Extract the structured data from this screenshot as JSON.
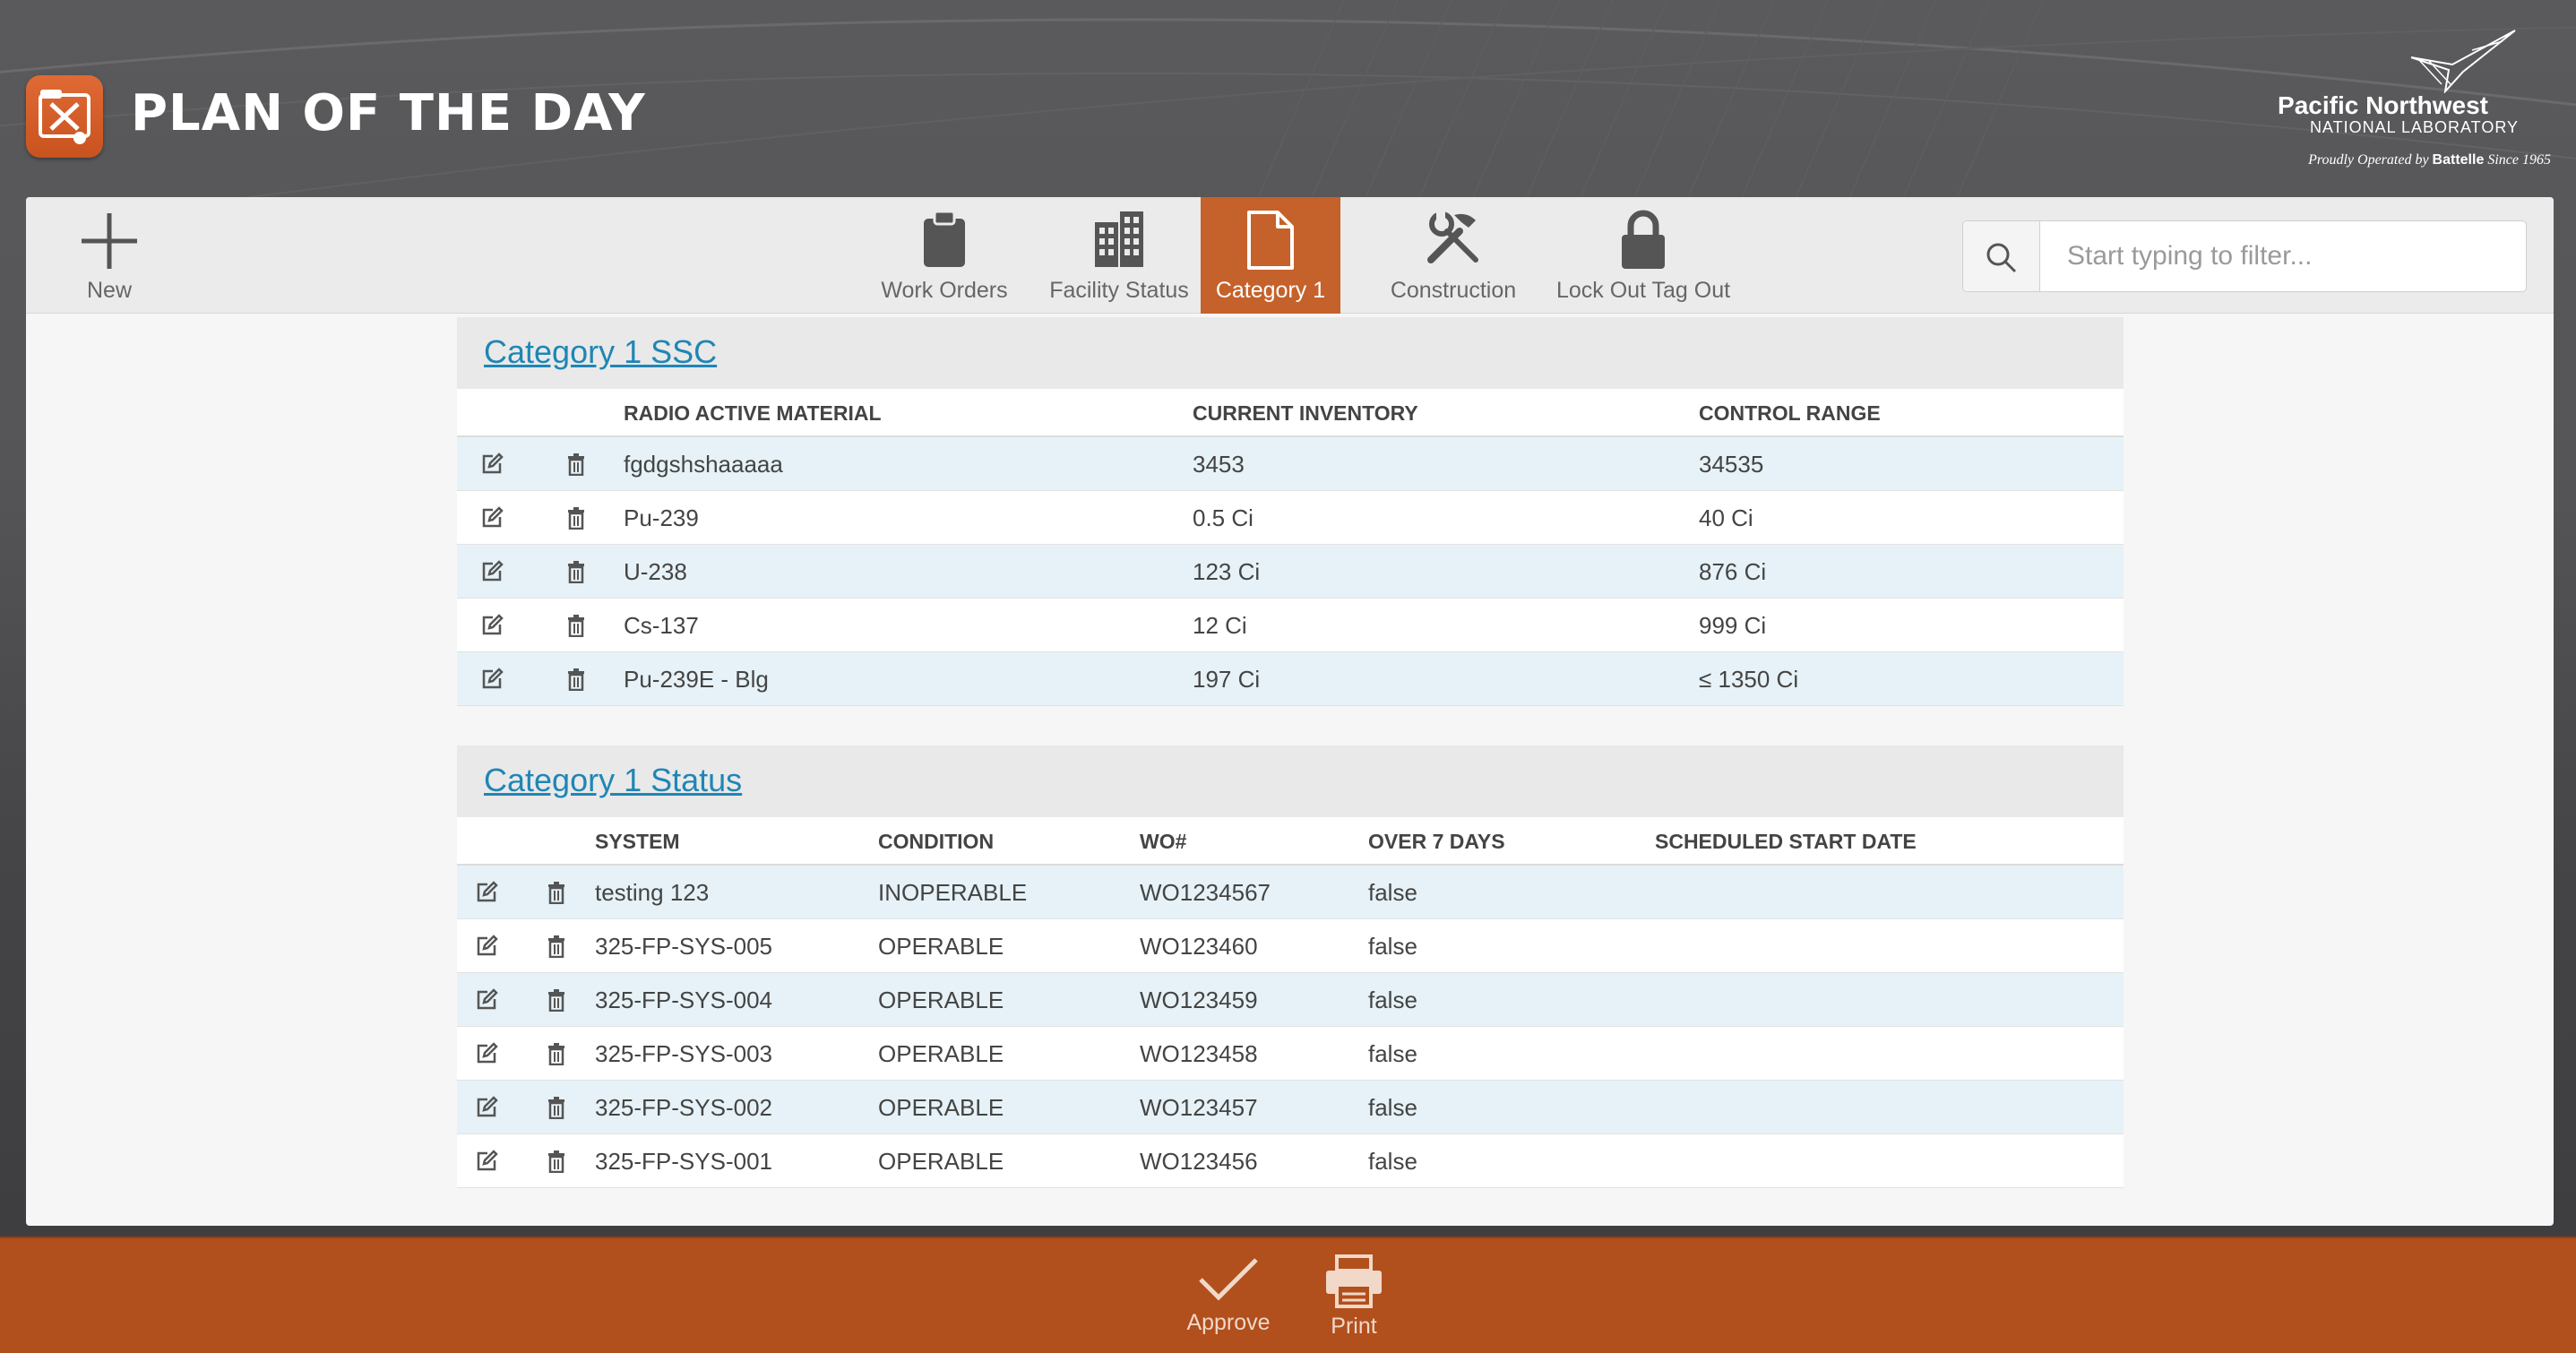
{
  "header": {
    "title": "PLAN OF THE DAY",
    "org_line1": "Pacific Northwest",
    "org_line2": "NATIONAL LABORATORY",
    "org_tagline_pre": "Proudly Operated by",
    "org_tagline_brand": "Battelle",
    "org_tagline_post": "Since 1965"
  },
  "toolbar": {
    "new_label": "New",
    "tabs": [
      {
        "label": "Work Orders",
        "icon": "clipboard-icon"
      },
      {
        "label": "Facility Status",
        "icon": "building-icon"
      },
      {
        "label": "Category 1",
        "icon": "document-icon",
        "active": true
      },
      {
        "label": "Construction",
        "icon": "tools-icon"
      },
      {
        "label": "Lock Out Tag Out",
        "icon": "lock-icon"
      }
    ],
    "filter_placeholder": "Start typing to filter..."
  },
  "ssc": {
    "title": "Category 1 SSC",
    "columns": [
      "RADIO ACTIVE MATERIAL",
      "CURRENT INVENTORY",
      "CONTROL RANGE"
    ],
    "rows": [
      [
        "fgdgshshaaaaa",
        "3453",
        "34535"
      ],
      [
        "Pu-239",
        "0.5 Ci",
        "40 Ci"
      ],
      [
        "U-238",
        "123 Ci",
        "876 Ci"
      ],
      [
        "Cs-137",
        "12 Ci",
        "999 Ci"
      ],
      [
        "Pu-239E - Blg",
        "197 Ci",
        "≤ 1350 Ci"
      ]
    ]
  },
  "status": {
    "title": "Category 1 Status",
    "columns": [
      "SYSTEM",
      "CONDITION",
      "WO#",
      "OVER 7 DAYS",
      "SCHEDULED START DATE"
    ],
    "rows": [
      [
        "testing 123",
        "INOPERABLE",
        "WO1234567",
        "false",
        ""
      ],
      [
        "325-FP-SYS-005",
        "OPERABLE",
        "WO123460",
        "false",
        ""
      ],
      [
        "325-FP-SYS-004",
        "OPERABLE",
        "WO123459",
        "false",
        ""
      ],
      [
        "325-FP-SYS-003",
        "OPERABLE",
        "WO123458",
        "false",
        ""
      ],
      [
        "325-FP-SYS-002",
        "OPERABLE",
        "WO123457",
        "false",
        ""
      ],
      [
        "325-FP-SYS-001",
        "OPERABLE",
        "WO123456",
        "false",
        ""
      ]
    ]
  },
  "footer": {
    "approve_label": "Approve",
    "print_label": "Print"
  },
  "colors": {
    "accent": "#c5612a",
    "footer": "#b14f1d",
    "link": "#1f86b5",
    "row_stripe": "#e6f2f7"
  }
}
